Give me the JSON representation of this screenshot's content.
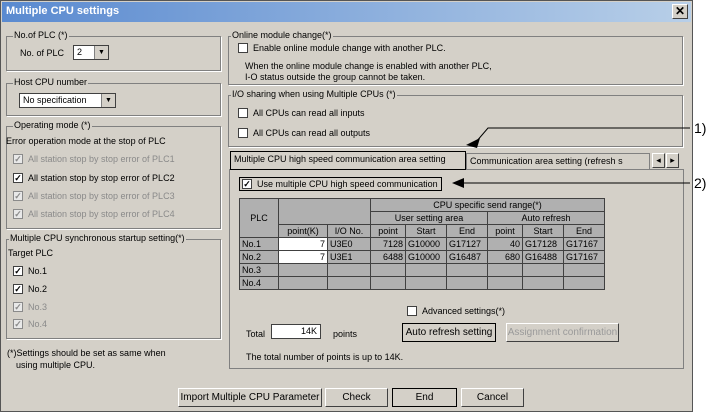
{
  "window": {
    "title": "Multiple CPU settings",
    "close_glyph": "✕"
  },
  "no_of_plc": {
    "group_label": "No.of PLC (*)",
    "label": "No. of PLC",
    "value": "2"
  },
  "host_cpu": {
    "group_label": "Host CPU number",
    "value": "No specification"
  },
  "operating_mode": {
    "group_label": "Operating mode (*)",
    "caption": "Error operation mode at the stop of PLC",
    "items": [
      {
        "label": "All station stop by stop error of PLC1",
        "checked": true,
        "enabled": false
      },
      {
        "label": "All station stop by stop error of PLC2",
        "checked": true,
        "enabled": true
      },
      {
        "label": "All station stop by stop error of PLC3",
        "checked": true,
        "enabled": false
      },
      {
        "label": "All station stop by stop error of PLC4",
        "checked": true,
        "enabled": false
      }
    ]
  },
  "sync_startup": {
    "group_label": "Multiple CPU synchronous startup setting(*)",
    "caption": "Target PLC",
    "items": [
      {
        "label": "No.1",
        "checked": true,
        "enabled": true
      },
      {
        "label": "No.2",
        "checked": true,
        "enabled": true
      },
      {
        "label": "No.3",
        "checked": true,
        "enabled": false
      },
      {
        "label": "No.4",
        "checked": true,
        "enabled": false
      }
    ]
  },
  "footnote": {
    "line1": "(*)Settings should be set as same when",
    "line2": "using multiple CPU."
  },
  "online_change": {
    "group_label": "Online module change(*)",
    "checkbox": "Enable online module change with another PLC.",
    "note1": "When the online module change is enabled  with another PLC,",
    "note2": "I-O status outside the group cannot be taken."
  },
  "io_sharing": {
    "group_label": "I/O sharing when using Multiple CPUs (*)",
    "inputs": "All CPUs can read all inputs",
    "outputs": "All CPUs can read all outputs"
  },
  "tabs": {
    "active": "Multiple CPU high speed communication area setting",
    "other": "Communication area setting (refresh s",
    "scroll_left": "◂",
    "scroll_right": "▸"
  },
  "high_speed": {
    "checkbox": "Use multiple CPU high speed communication",
    "table": {
      "title": "CPU specific send range(*)",
      "plc_header": "PLC",
      "user_area": "User setting area",
      "auto_refresh": "Auto refresh",
      "cols": [
        "point(K)",
        "I/O No.",
        "point",
        "Start",
        "End",
        "point",
        "Start",
        "End"
      ],
      "rows": [
        {
          "plc": "No.1",
          "cells": [
            "7",
            "U3E0",
            "7128",
            "G10000",
            "G17127",
            "40",
            "G17128",
            "G17167"
          ]
        },
        {
          "plc": "No.2",
          "cells": [
            "7",
            "U3E1",
            "6488",
            "G10000",
            "G16487",
            "680",
            "G16488",
            "G17167"
          ]
        },
        {
          "plc": "No.3",
          "cells": [
            "",
            "",
            "",
            "",
            "",
            "",
            "",
            ""
          ]
        },
        {
          "plc": "No.4",
          "cells": [
            "",
            "",
            "",
            "",
            "",
            "",
            "",
            ""
          ]
        }
      ]
    },
    "advanced": "Advanced settings(*)",
    "total_label": "Total",
    "total_value": "14K",
    "points_label": "points",
    "auto_refresh_btn": "Auto refresh setting",
    "assignment_btn": "Assignment confirmation",
    "limit_note": "The total number of points is up to 14K."
  },
  "buttons": {
    "import": "Import Multiple CPU Parameter",
    "check": "Check",
    "end": "End",
    "cancel": "Cancel"
  },
  "callouts": {
    "one": "1)",
    "two": "2)"
  },
  "check_glyph": "✓",
  "arrow_glyph": "▼"
}
